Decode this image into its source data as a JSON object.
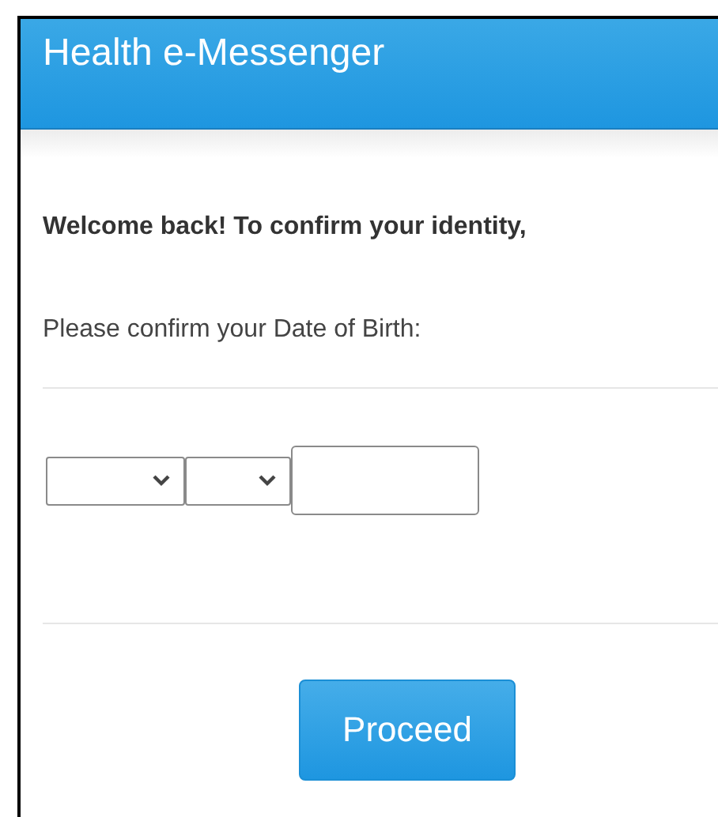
{
  "header": {
    "title": "Health e-Messenger"
  },
  "welcome": "Welcome back! To confirm your identity,",
  "prompt": "Please confirm your Date of Birth:",
  "dob_fields": [
    {
      "kind": "select"
    },
    {
      "kind": "select"
    },
    {
      "kind": "text"
    }
  ],
  "button": "Proceed"
}
